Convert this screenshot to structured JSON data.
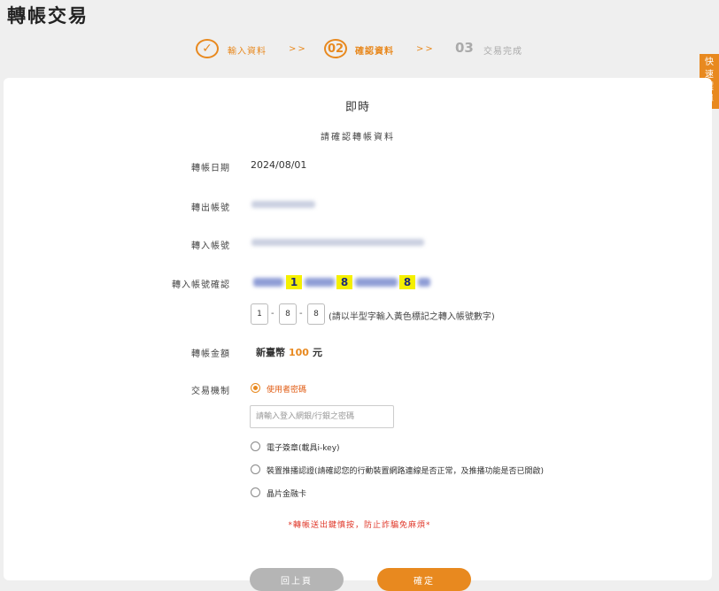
{
  "page": {
    "title": "轉帳交易"
  },
  "steps": [
    {
      "num": "✓",
      "label": "輸入資料"
    },
    {
      "num": "02",
      "label": "確認資料"
    },
    {
      "num": "03",
      "label": "交易完成"
    }
  ],
  "steps_separator": ">>",
  "quick_menu": {
    "label": [
      "快",
      "速",
      "選",
      "單"
    ]
  },
  "card": {
    "title": "即時",
    "subtitle": "請確認轉帳資料"
  },
  "fields": {
    "date": {
      "label": "轉帳日期",
      "value": "2024/08/01"
    },
    "from_account": {
      "label": "轉出帳號"
    },
    "to_account": {
      "label": "轉入帳號"
    },
    "confirm_account": {
      "label": "轉入帳號確認",
      "highlight_digits": [
        "1",
        "8",
        "8"
      ],
      "input_values": [
        "1",
        "8",
        "8"
      ],
      "hint": "(請以半型字輸入黃色標記之轉入帳號數字)"
    },
    "amount": {
      "label": "轉帳金額",
      "currency": "新臺幣",
      "value": "100",
      "unit": "元"
    },
    "mechanism": {
      "label": "交易機制",
      "options": [
        {
          "label": "使用者密碼",
          "selected": true
        },
        {
          "label": "電子簽章(載具i-key)",
          "selected": false
        },
        {
          "label": "裝置推播認證(請確認您的行動裝置網路連線是否正常，及推播功能是否已開啟)",
          "selected": false
        },
        {
          "label": "晶片金融卡",
          "selected": false
        }
      ],
      "password_placeholder": "請輸入登入網銀/行銀之密碼"
    }
  },
  "warning": "*轉帳送出鍵慎按，防止詐騙免麻煩*",
  "buttons": {
    "back": "回上頁",
    "confirm": "確定"
  },
  "colors": {
    "accent": "#e8891f",
    "warning": "#e0392b",
    "highlight": "#f5f000"
  }
}
